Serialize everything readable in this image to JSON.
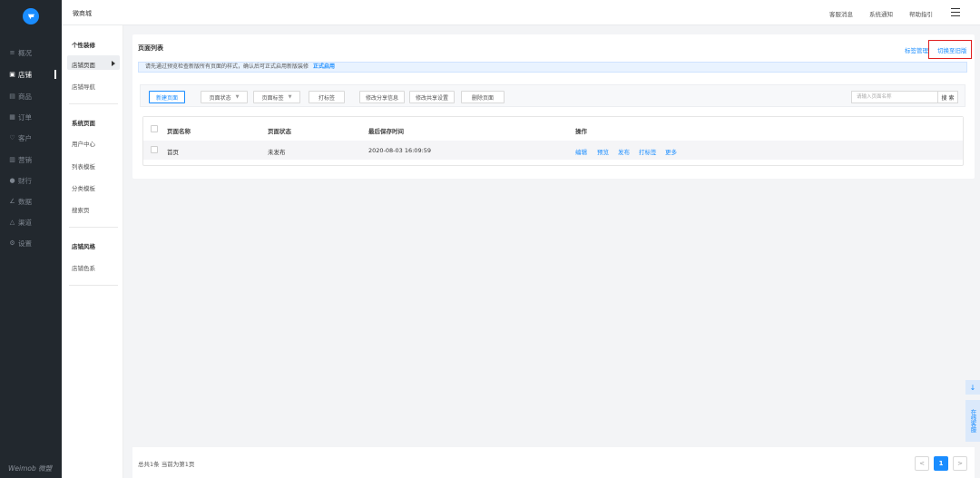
{
  "brand": "Weimob 微盟",
  "sidebar": {
    "items": [
      {
        "icon": "list-icon",
        "label": "概况"
      },
      {
        "icon": "store-icon",
        "label": "店铺"
      },
      {
        "icon": "goods-icon",
        "label": "商品"
      },
      {
        "icon": "order-icon",
        "label": "订单"
      },
      {
        "icon": "customer-icon",
        "label": "客户"
      },
      {
        "icon": "marketing-icon",
        "label": "营销"
      },
      {
        "icon": "finance-icon",
        "label": "财行"
      },
      {
        "icon": "data-icon",
        "label": "数据"
      },
      {
        "icon": "channel-icon",
        "label": "渠道"
      },
      {
        "icon": "settings-icon",
        "label": "设置"
      }
    ]
  },
  "topbar": {
    "app_title": "微商城",
    "links": [
      "客服消息",
      "系统通知",
      "帮助指引"
    ]
  },
  "subnav": {
    "group1": "个性装修",
    "group1_items": [
      "店铺页面",
      "店铺导航"
    ],
    "group2": "系统页面",
    "group2_items": [
      "用户中心",
      "列表模板",
      "分类模板",
      "搜索页"
    ],
    "group3": "店铺风格",
    "group3_items": [
      "店铺色系"
    ]
  },
  "main": {
    "title": "页面列表",
    "tag_manage": "标签管理",
    "switch_old": "切换至旧版",
    "notice": "请先通过预览检查新版所有页面的样式，确认后可正式启用新版装修",
    "notice_link": "正式启用",
    "toolbar": {
      "new_page": "新建页面",
      "page_status": "页面状态",
      "page_tag": "页面标签",
      "tag": "打标签",
      "edit_share": "修改分享信息",
      "edit_share_settings": "修改共享设置",
      "delete_page": "删除页面",
      "search_placeholder": "请输入页面名称",
      "search_btn": "搜 索"
    },
    "table": {
      "headers": [
        "页面名称",
        "页面状态",
        "最后保存时间",
        "操作"
      ],
      "rows": [
        {
          "name": "首页",
          "status": "未发布",
          "time": "2020-08-03 16:09:59",
          "ops": [
            "编辑",
            "预览",
            "发布",
            "打标签",
            "更多"
          ]
        }
      ]
    }
  },
  "footer": {
    "total": "总共1条 当前为第1页",
    "current_page": "1",
    "prev": "<",
    "next": ">"
  },
  "float": {
    "download": "↓",
    "service": "在线客服"
  }
}
